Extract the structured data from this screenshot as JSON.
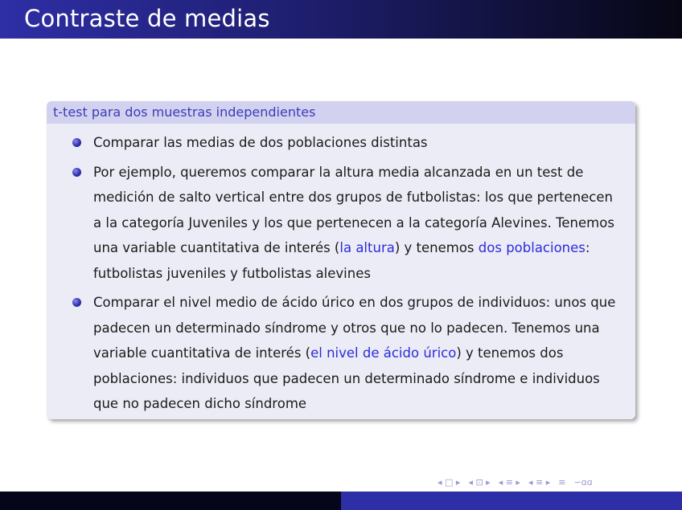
{
  "slide": {
    "title": "Contraste de medias"
  },
  "block": {
    "title": "t-test para dos muestras independientes",
    "items": [
      {
        "text": "Comparar las medias de dos poblaciones distintas"
      },
      {
        "text_before": "Por ejemplo, queremos comparar la altura media alcanzada en un test de medición de salto vertical entre dos grupos de futbolistas: los que pertenecen a la categoría Juveniles y los que pertenecen a la categoría Alevines. Tenemos una variable cuantitativa de interés (",
        "highlight1": "la altura",
        "text_middle": ") y tenemos ",
        "highlight2": "dos poblaciones",
        "text_after": ": futbolistas juveniles y futbolistas alevines"
      },
      {
        "text_before": "Comparar el nivel medio de ácido úrico en dos grupos de individuos: unos que padecen un determinado síndrome y otros que no lo padecen. Tenemos una variable cuantitativa de interés (",
        "highlight1": "el nivel de ácido úrico",
        "text_after": ") y tenemos dos poblaciones: individuos que padecen un determinado síndrome e individuos que no padecen dicho síndrome"
      }
    ]
  },
  "navigation": {
    "frame": "◂ □ ▸",
    "subsection": "◂ ⊡ ▸",
    "section": "◂ ≡ ▸",
    "subsubsection": "◂ ≡ ▸",
    "align": "≡",
    "search": "∽ɑɑ"
  },
  "colors": {
    "accent": "#2e2ea6",
    "highlight": "#2b2bdc",
    "block_title_bg": "#d2d2f0",
    "block_body_bg": "#ececf6"
  }
}
